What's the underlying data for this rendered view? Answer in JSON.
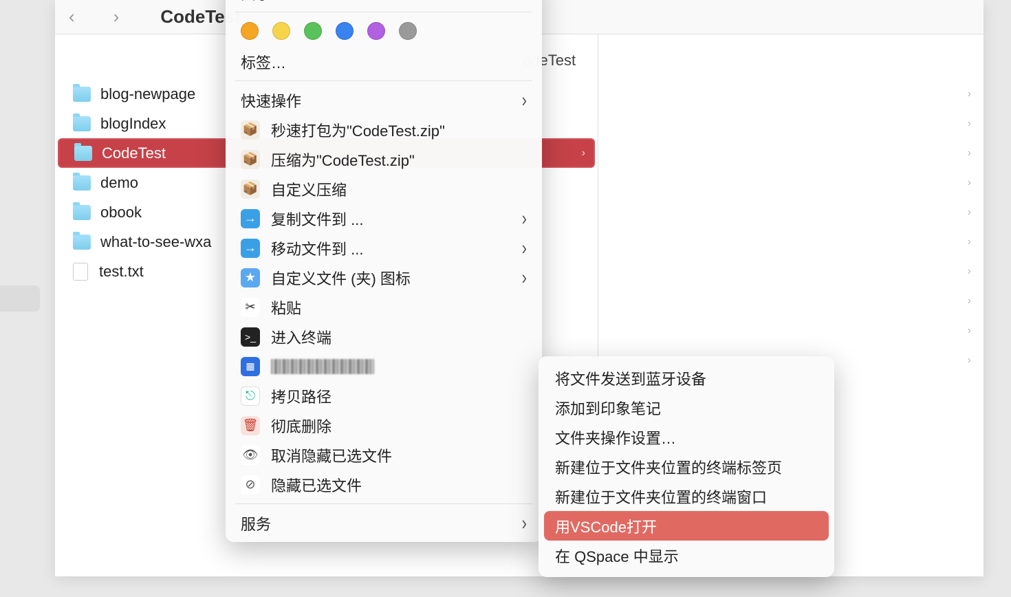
{
  "toolbar": {
    "title": "CodeTest",
    "breadcrumb_fragment": "odeTest"
  },
  "files": [
    {
      "name": "blog-newpage",
      "type": "folder",
      "selected": false
    },
    {
      "name": "blogIndex",
      "type": "folder",
      "selected": false
    },
    {
      "name": "CodeTest",
      "type": "folder",
      "selected": true
    },
    {
      "name": "demo",
      "type": "folder",
      "selected": false
    },
    {
      "name": "obook",
      "type": "folder",
      "selected": false
    },
    {
      "name": "what-to-see-wxa",
      "type": "folder",
      "selected": false
    },
    {
      "name": "test.txt",
      "type": "file",
      "selected": false
    }
  ],
  "context_menu": {
    "share": "共享",
    "tags_label": "标签…",
    "tag_colors": [
      "#f5a623",
      "#f7d54a",
      "#5ac25a",
      "#3a82f0",
      "#b060e0",
      "#9a9a9a"
    ],
    "quick_actions": "快速操作",
    "items": [
      {
        "label": "秒速打包为\"CodeTest.zip\"",
        "icon": "zip"
      },
      {
        "label": "压缩为\"CodeTest.zip\"",
        "icon": "zip"
      },
      {
        "label": "自定义压缩",
        "icon": "zip"
      },
      {
        "label": "复制文件到 ...",
        "icon": "copy",
        "sub": true
      },
      {
        "label": "移动文件到 ...",
        "icon": "move",
        "sub": true
      },
      {
        "label": "自定义文件 (夹) 图标",
        "icon": "star",
        "sub": true
      },
      {
        "label": "粘贴",
        "icon": "paste"
      },
      {
        "label": "进入终端",
        "icon": "term"
      },
      {
        "label": "",
        "icon": "blue",
        "censored": true
      },
      {
        "label": "拷贝路径",
        "icon": "path"
      },
      {
        "label": "彻底删除",
        "icon": "del"
      },
      {
        "label": "取消隐藏已选文件",
        "icon": "eye"
      },
      {
        "label": "隐藏已选文件",
        "icon": "eye-off"
      }
    ],
    "services": "服务"
  },
  "submenu": {
    "items": [
      "将文件发送到蓝牙设备",
      "添加到印象笔记",
      "文件夹操作设置…",
      "新建位于文件夹位置的终端标签页",
      "新建位于文件夹位置的终端窗口",
      "用VSCode打开",
      "在 QSpace 中显示"
    ],
    "highlight_index": 5
  }
}
